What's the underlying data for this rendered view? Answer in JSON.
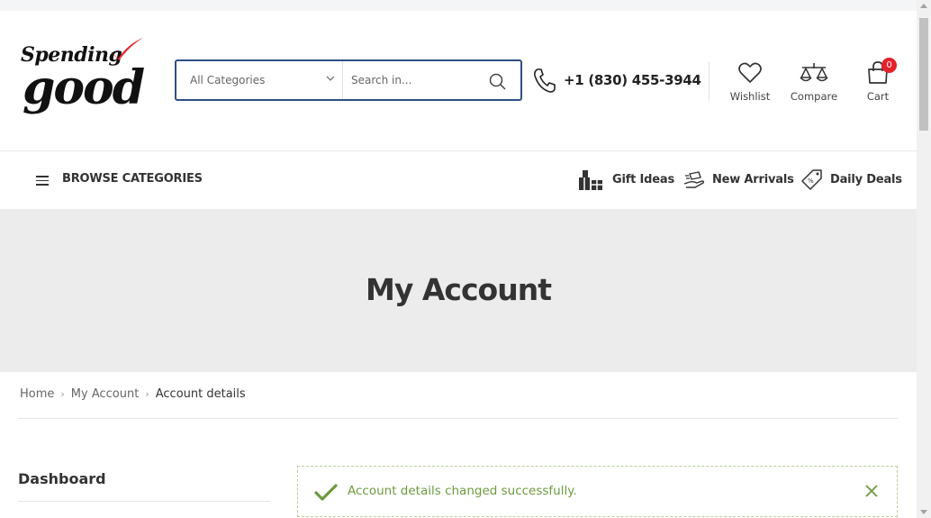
{
  "logo": {
    "line1": "Spending",
    "line2": "good"
  },
  "search": {
    "category": "All Categories",
    "placeholder": "Search in..."
  },
  "phone": "+1 (830) 455-3944",
  "header_icons": {
    "wishlist": "Wishlist",
    "compare": "Compare",
    "cart": "Cart",
    "cart_count": "0"
  },
  "nav": {
    "browse": "BROWSE CATEGORIES",
    "links": [
      "Gift Ideas",
      "New Arrivals",
      "Daily Deals"
    ]
  },
  "page_title": "My Account",
  "breadcrumb": [
    "Home",
    "My Account",
    "Account details"
  ],
  "sidebar": {
    "first_item": "Dashboard"
  },
  "notice": {
    "message": "Account details changed successfully."
  },
  "colors": {
    "accent": "#2f4f85",
    "badge": "#e3222c",
    "success": "#6d9a3f",
    "logo_check": "#e3222c"
  }
}
